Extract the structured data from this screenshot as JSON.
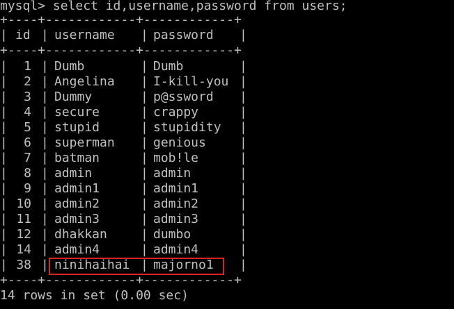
{
  "terminal": {
    "command_line": "mysql> select id,username,password from users;",
    "border_top": "+----+------------+------------+",
    "border_mid": "+----+------------+------------+",
    "border_bottom": "+----+------------+------------+",
    "status": "14 rows in set (0.00 sec)",
    "highlight_color": "#e02020"
  },
  "table": {
    "columns": [
      "id",
      "username",
      "password"
    ],
    "rows": [
      {
        "id": "1",
        "username": "Dumb",
        "password": "Dumb"
      },
      {
        "id": "2",
        "username": "Angelina",
        "password": "I-kill-you"
      },
      {
        "id": "3",
        "username": "Dummy",
        "password": "p@ssword"
      },
      {
        "id": "4",
        "username": "secure",
        "password": "crappy"
      },
      {
        "id": "5",
        "username": "stupid",
        "password": "stupidity"
      },
      {
        "id": "6",
        "username": "superman",
        "password": "genious"
      },
      {
        "id": "7",
        "username": "batman",
        "password": "mob!le"
      },
      {
        "id": "8",
        "username": "admin",
        "password": "admin"
      },
      {
        "id": "9",
        "username": "admin1",
        "password": "admin1"
      },
      {
        "id": "10",
        "username": "admin2",
        "password": "admin2"
      },
      {
        "id": "11",
        "username": "admin3",
        "password": "admin3"
      },
      {
        "id": "12",
        "username": "dhakkan",
        "password": "dumbo"
      },
      {
        "id": "14",
        "username": "admin4",
        "password": "admin4"
      },
      {
        "id": "38",
        "username": "ninihaihai",
        "password": "majorno1"
      }
    ]
  }
}
